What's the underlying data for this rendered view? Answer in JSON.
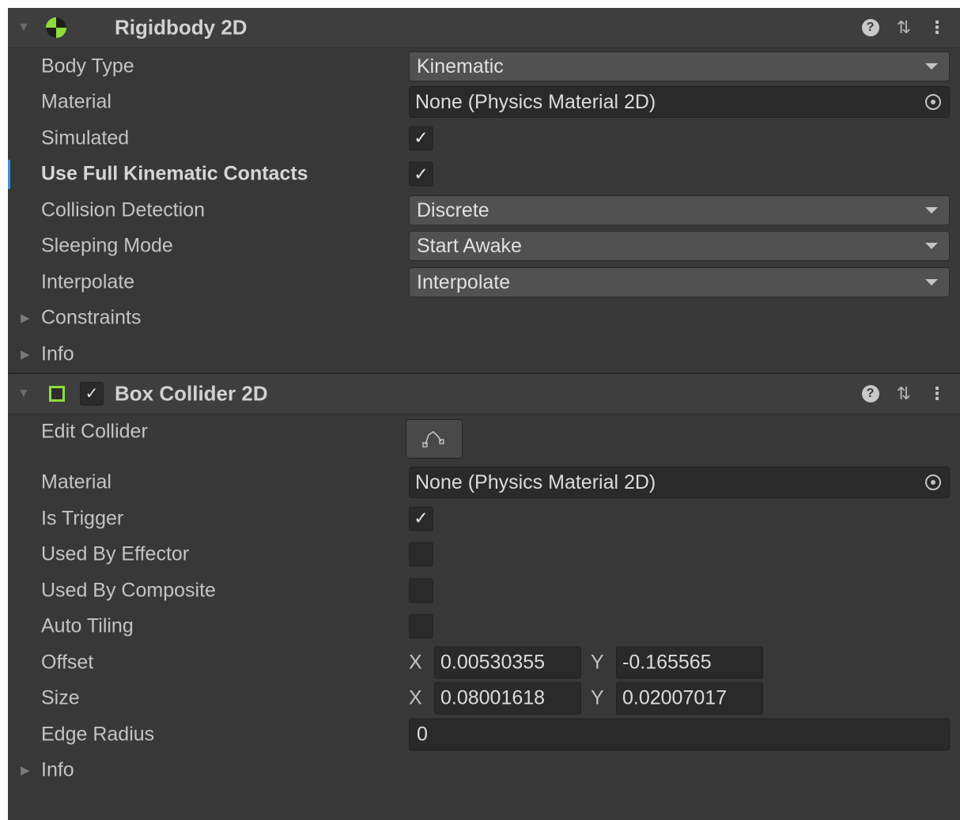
{
  "rigidbody": {
    "title": "Rigidbody 2D",
    "icon": "rigidbody2d-icon",
    "accent": "#8fdc3a",
    "rows": {
      "body_type": {
        "label": "Body Type",
        "value": "Kinematic"
      },
      "material": {
        "label": "Material",
        "value": "None (Physics Material 2D)"
      },
      "simulated": {
        "label": "Simulated",
        "checked": true
      },
      "full_kinematic": {
        "label": "Use Full Kinematic Contacts",
        "checked": true
      },
      "collision_detection": {
        "label": "Collision Detection",
        "value": "Discrete"
      },
      "sleeping_mode": {
        "label": "Sleeping Mode",
        "value": "Start Awake"
      },
      "interpolate": {
        "label": "Interpolate",
        "value": "Interpolate"
      },
      "constraints": {
        "label": "Constraints"
      },
      "info": {
        "label": "Info"
      }
    }
  },
  "box_collider": {
    "title": "Box Collider 2D",
    "icon": "box-collider2d-icon",
    "enabled": true,
    "rows": {
      "edit_collider": {
        "label": "Edit Collider",
        "icon": "edit-collider-icon"
      },
      "material": {
        "label": "Material",
        "value": "None (Physics Material 2D)"
      },
      "is_trigger": {
        "label": "Is Trigger",
        "checked": true
      },
      "used_by_effector": {
        "label": "Used By Effector",
        "checked": false
      },
      "used_by_composite": {
        "label": "Used By Composite",
        "checked": false
      },
      "auto_tiling": {
        "label": "Auto Tiling",
        "checked": false
      },
      "offset": {
        "label": "Offset",
        "x_label": "X",
        "x": "0.00530355",
        "y_label": "Y",
        "y": "-0.165565"
      },
      "size": {
        "label": "Size",
        "x_label": "X",
        "x": "0.08001618",
        "y_label": "Y",
        "y": "0.02007017"
      },
      "edge_radius": {
        "label": "Edge Radius",
        "value": "0"
      },
      "info": {
        "label": "Info"
      }
    }
  },
  "glyphs": {
    "check": "✓",
    "help": "?",
    "presets": "⇅",
    "menu": "⋮",
    "fold_open": "▼",
    "fold_closed": "▶"
  }
}
